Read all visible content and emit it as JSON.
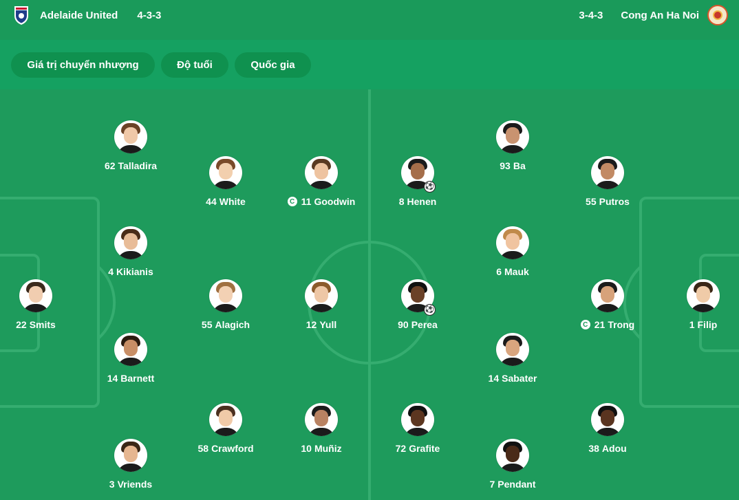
{
  "home": {
    "name": "Adelaide United",
    "formation": "4-3-3",
    "badge_icon": "adelaide-united-badge",
    "accent": "#c8102e"
  },
  "away": {
    "name": "Cong An Ha Noi",
    "formation": "3-4-3",
    "badge_icon": "cong-an-ha-noi-badge",
    "accent": "#c7372a"
  },
  "tabs": [
    {
      "label": "Giá trị chuyển nhượng"
    },
    {
      "label": "Độ tuổi"
    },
    {
      "label": "Quốc gia"
    }
  ],
  "colors": {
    "pitch": "#1e9b5c",
    "header": "#1a9a5a",
    "tab_bg": "#0f914f",
    "line": "#35ad70"
  },
  "home_players": [
    {
      "number": "62",
      "name": "Talladira"
    },
    {
      "number": "44",
      "name": "White"
    },
    {
      "number": "11",
      "name": "Goodwin",
      "captain": true
    },
    {
      "number": "4",
      "name": "Kikianis"
    },
    {
      "number": "22",
      "name": "Smits"
    },
    {
      "number": "55",
      "name": "Alagich"
    },
    {
      "number": "12",
      "name": "Yull"
    },
    {
      "number": "14",
      "name": "Barnett"
    },
    {
      "number": "58",
      "name": "Crawford"
    },
    {
      "number": "10",
      "name": "Muñiz"
    },
    {
      "number": "3",
      "name": "Vriends"
    }
  ],
  "away_players": [
    {
      "number": "8",
      "name": "Henen",
      "goal": true
    },
    {
      "number": "93",
      "name": "Ba"
    },
    {
      "number": "55",
      "name": "Putros"
    },
    {
      "number": "6",
      "name": "Mauk"
    },
    {
      "number": "90",
      "name": "Perea",
      "goal": true
    },
    {
      "number": "21",
      "name": "Trong",
      "captain": true
    },
    {
      "number": "1",
      "name": "Filip"
    },
    {
      "number": "14",
      "name": "Sabater"
    },
    {
      "number": "72",
      "name": "Grafite"
    },
    {
      "number": "38",
      "name": "Adou"
    },
    {
      "number": "7",
      "name": "Pendant"
    }
  ],
  "captain_mark": "C",
  "goal_icon": "⚽"
}
